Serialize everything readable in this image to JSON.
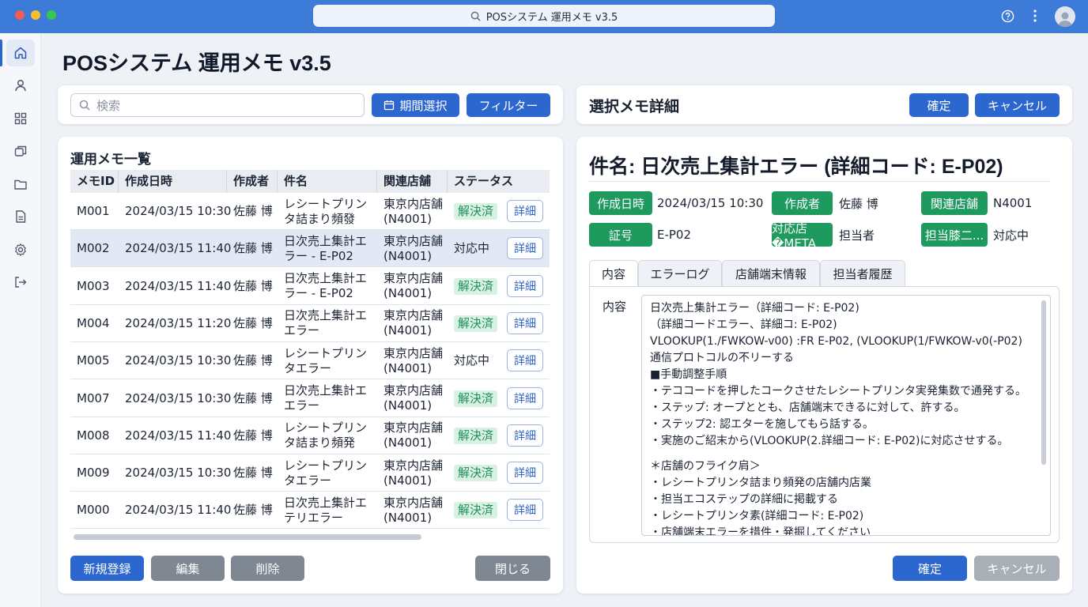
{
  "window": {
    "url": "POSシステム 運用メモ v3.5"
  },
  "page": {
    "title": "POSシステム 運用メモ v3.5"
  },
  "search": {
    "placeholder": "検索",
    "period_button": "期間選択",
    "filter_button": "フィルター"
  },
  "list": {
    "title": "運用メモ一覧",
    "columns": [
      "メモID",
      "作成日時",
      "作成者",
      "件名",
      "関連店舗",
      "ステータス"
    ],
    "detail_label": "詳細",
    "rows": [
      {
        "id": "M001",
        "date": "2024/03/15 10:30",
        "author": "佐藤 博",
        "subject1": "レシートプリン",
        "subject2": "タ詰まり頻發",
        "store1": "東京内店舗",
        "store2": "(N4001)",
        "status": "解決済",
        "status_type": "done"
      },
      {
        "id": "M002",
        "date": "2024/03/15 11:40",
        "author": "佐藤 博",
        "subject1": "日次売上集計エ",
        "subject2": "ラー - E-P02",
        "store1": "東京内店舗",
        "store2": "(N4001)",
        "status": "対応中",
        "status_type": "wip"
      },
      {
        "id": "M003",
        "date": "2024/03/15 11:40",
        "author": "佐藤 博",
        "subject1": "日次売上集計エ",
        "subject2": "ラー - E-P02",
        "store1": "東京内店舗",
        "store2": "(N4001)",
        "status": "解決済",
        "status_type": "done"
      },
      {
        "id": "M004",
        "date": "2024/03/15 11:20",
        "author": "佐藤 博",
        "subject1": "日次売上集計エ",
        "subject2": "エラー",
        "store1": "東京内店舗",
        "store2": "(N4001)",
        "status": "解決済",
        "status_type": "done"
      },
      {
        "id": "M005",
        "date": "2024/03/15 10:30",
        "author": "佐藤 博",
        "subject1": "レシートプリン",
        "subject2": "タエラー",
        "store1": "東京内店舗",
        "store2": "(N4001)",
        "status": "対応中",
        "status_type": "wip"
      },
      {
        "id": "M007",
        "date": "2024/03/15 10:30",
        "author": "佐藤 博",
        "subject1": "日次売上集計エ",
        "subject2": "エラー",
        "store1": "東京内店舗",
        "store2": "(N4001)",
        "status": "解決済",
        "status_type": "done"
      },
      {
        "id": "M008",
        "date": "2024/03/15 11:40",
        "author": "佐藤 博",
        "subject1": "レシートプリン",
        "subject2": "タ詰まり頻発",
        "store1": "東京内店舗",
        "store2": "(N4001)",
        "status": "解決済",
        "status_type": "done"
      },
      {
        "id": "M009",
        "date": "2024/03/15 10:30",
        "author": "佐藤 博",
        "subject1": "レシートプリン",
        "subject2": "タエラー",
        "store1": "東京内店舗",
        "store2": "(N4001)",
        "status": "解決済",
        "status_type": "done"
      },
      {
        "id": "M000",
        "date": "2024/03/15 11:40",
        "author": "佐藤 博",
        "subject1": "日次売上集計エ",
        "subject2": "テリエラー",
        "store1": "東京内店舗",
        "store2": "(N4001)",
        "status": "解決済",
        "status_type": "done"
      }
    ],
    "actions": {
      "new": "新規登録",
      "edit": "編集",
      "delete": "削除",
      "close": "閉じる"
    }
  },
  "detail": {
    "header_title": "選択メモ詳細",
    "confirm_button": "確定",
    "cancel_button": "キャンセル",
    "subject": "件名: 日次売上集計エラー (詳細コード: E-P02)",
    "meta": {
      "created_label": "作成日時",
      "created_value": "2024/03/15 10:30",
      "author_label": "作成者",
      "author_value": "佐藤 博",
      "store_label": "関連店舗",
      "store_value": "N4001",
      "cert_label": "証号",
      "cert_value": "E-P02",
      "handling_label": "対応店�META",
      "handling_value": "担当者",
      "owner_label": "担当膝二...",
      "owner_value": "対応中"
    },
    "tabs": [
      "内容",
      "エラーログ",
      "店舗端末情報",
      "担当者履歴"
    ],
    "content_label": "内容",
    "content_lines": [
      "日次売上集計エラー（詳細コード: E-P02)",
      "（詳細コードエラー、詳細コ: E-P02)",
      "VLOOKUP(1./FWKOW-v00) :FR E-P02, (VLOOKUP(1/FWKOW-v0(-P02)",
      "通信プロトコルの不リーする",
      "■手動調整手順",
      "・テココードを押したコークさせたレシートプリンタ実発集数で通発する。",
      "・ステップ: オープととも、店舗端末できるに対して、許する。",
      "・ステップ2: 認エターを施してもら話する。",
      "・実施のご紹末から(VLOOKUP(2.詳細コード: E-P02)に対応させする。",
      "",
      "＊店舗のフライク肩＞",
      "・レシートプリンタ詰まり頻発の店舗内店業",
      "・担当エコステップの詳細に掲載する",
      "・レシートプリンタ素(詳細コード: E-P02)",
      "・店舗端末エラーを措件・発掘してください"
    ],
    "footer_confirm": "確定",
    "footer_cancel": "キャンセル"
  },
  "colors": {
    "accent": "#2c66cf",
    "titlebar": "#3d7bd8",
    "status_green": "#1e9a5f"
  },
  "icons": {
    "sidebar": [
      "home-icon",
      "user-icon",
      "grid-icon",
      "layers-icon",
      "folder-icon",
      "document-icon",
      "gear-icon",
      "logout-icon"
    ]
  }
}
